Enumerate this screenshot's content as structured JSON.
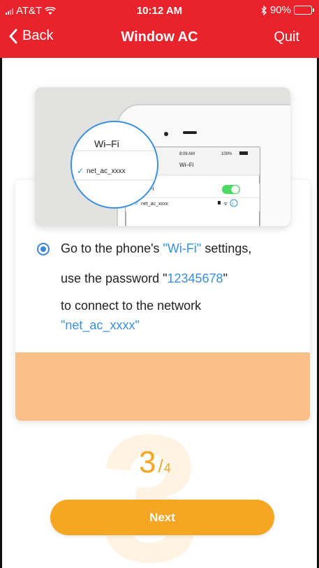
{
  "status_bar": {
    "carrier": "AT&T",
    "time": "10:12 AM",
    "battery": "90%",
    "battery_color": "#f5e400"
  },
  "nav": {
    "back_label": "Back",
    "title": "Window AC",
    "quit_label": "Quit"
  },
  "illustration": {
    "wifi_title": "Wi–Fi",
    "network_name": "net_ac_xxxx",
    "phone_time": "8:08 AM",
    "phone_battery": "100%",
    "phone_title": "Wi–Fi",
    "wifi_row": "Wi–Fi",
    "network_row": "net_ac_xxxx"
  },
  "instruction": {
    "line1_pre": "Go to the phone's ",
    "line1_highlight": "\"Wi-Fi\"",
    "line1_post": " settings,",
    "line2_pre": "use the password \"",
    "line2_highlight": "12345678",
    "line2_post": "\"",
    "line3": "to connect to the network",
    "line4_highlight": "\"net_ac_xxxx\""
  },
  "step": {
    "current": "3",
    "separator": "/",
    "total": "4"
  },
  "buttons": {
    "next_label": "Next"
  },
  "colors": {
    "header": "#e8232b",
    "accent": "#f5a623",
    "link": "#3a8fe0",
    "card_footer": "#fbbf88"
  }
}
